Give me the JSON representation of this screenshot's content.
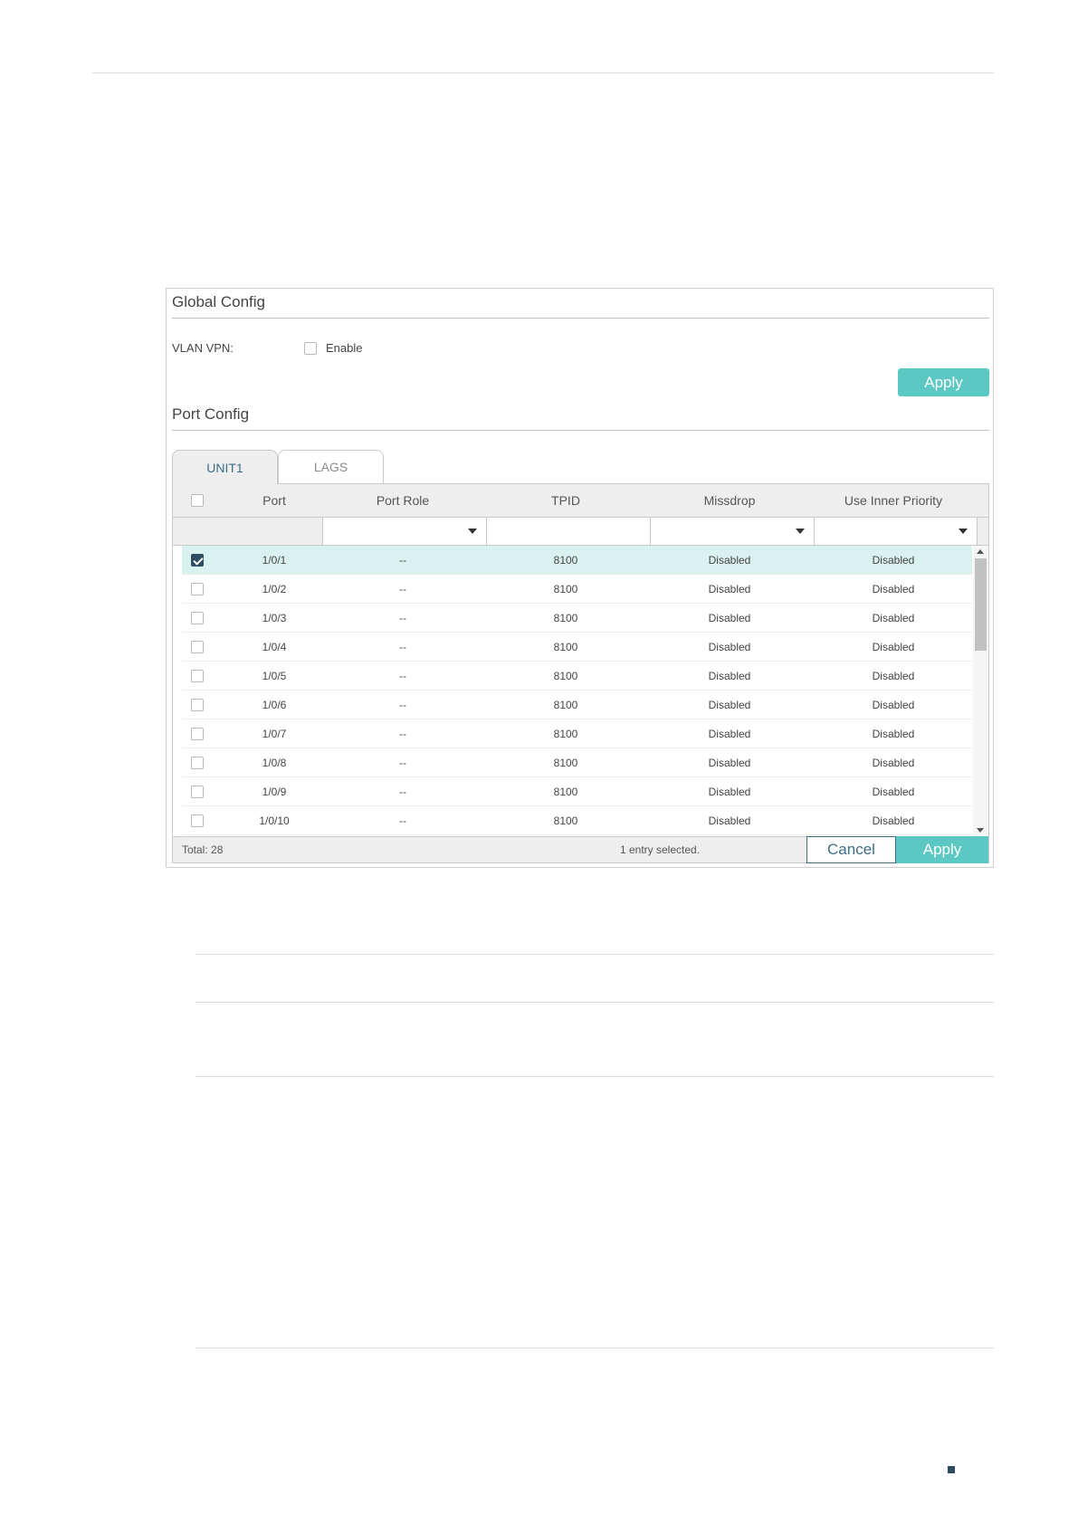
{
  "global_config": {
    "title": "Global Config",
    "vlan_vpn_label": "VLAN VPN:",
    "enable_label": "Enable",
    "apply_label": "Apply"
  },
  "port_config": {
    "title": "Port Config",
    "tabs": [
      {
        "label": "UNIT1",
        "active": true
      },
      {
        "label": "LAGS",
        "active": false
      }
    ],
    "columns": [
      "Port",
      "Port Role",
      "TPID",
      "Missdrop",
      "Use Inner Priority"
    ],
    "rows": [
      {
        "checked": true,
        "port": "1/0/1",
        "role": "--",
        "tpid": "8100",
        "missdrop": "Disabled",
        "inner_priority": "Disabled"
      },
      {
        "checked": false,
        "port": "1/0/2",
        "role": "--",
        "tpid": "8100",
        "missdrop": "Disabled",
        "inner_priority": "Disabled"
      },
      {
        "checked": false,
        "port": "1/0/3",
        "role": "--",
        "tpid": "8100",
        "missdrop": "Disabled",
        "inner_priority": "Disabled"
      },
      {
        "checked": false,
        "port": "1/0/4",
        "role": "--",
        "tpid": "8100",
        "missdrop": "Disabled",
        "inner_priority": "Disabled"
      },
      {
        "checked": false,
        "port": "1/0/5",
        "role": "--",
        "tpid": "8100",
        "missdrop": "Disabled",
        "inner_priority": "Disabled"
      },
      {
        "checked": false,
        "port": "1/0/6",
        "role": "--",
        "tpid": "8100",
        "missdrop": "Disabled",
        "inner_priority": "Disabled"
      },
      {
        "checked": false,
        "port": "1/0/7",
        "role": "--",
        "tpid": "8100",
        "missdrop": "Disabled",
        "inner_priority": "Disabled"
      },
      {
        "checked": false,
        "port": "1/0/8",
        "role": "--",
        "tpid": "8100",
        "missdrop": "Disabled",
        "inner_priority": "Disabled"
      },
      {
        "checked": false,
        "port": "1/0/9",
        "role": "--",
        "tpid": "8100",
        "missdrop": "Disabled",
        "inner_priority": "Disabled"
      },
      {
        "checked": false,
        "port": "1/0/10",
        "role": "--",
        "tpid": "8100",
        "missdrop": "Disabled",
        "inner_priority": "Disabled"
      }
    ],
    "footer": {
      "total": "Total: 28",
      "selected": "1 entry selected.",
      "cancel_label": "Cancel",
      "apply_label": "Apply"
    }
  },
  "colors": {
    "accent": "#5bc8c3",
    "selected_row": "#d9f2ef",
    "dark": "#2e4c5f"
  }
}
